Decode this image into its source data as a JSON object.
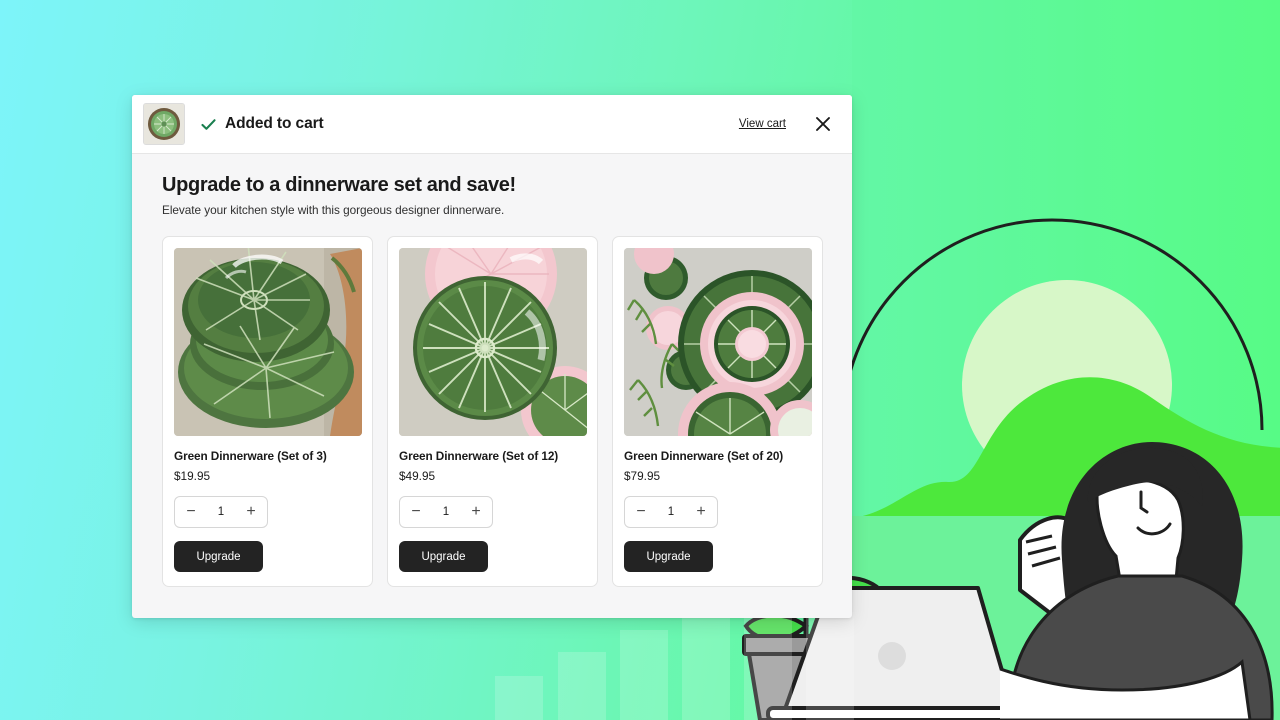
{
  "background": {
    "gradient_from": "#7DF4FA",
    "gradient_to": "#57FB86",
    "hill_color": "#4DE83C",
    "sun_color": "#D7F7C8",
    "coin_color": "#FBE56B",
    "accent_green": "#3FD935"
  },
  "header": {
    "thumbnail_alt": "Green Dinnerware plate thumbnail",
    "check_icon": "check-icon",
    "check_color": "#1a7f4f",
    "title": "Added to cart",
    "view_cart_label": "View cart",
    "close_icon": "close-icon"
  },
  "promo": {
    "title": "Upgrade to a dinnerware set and save!",
    "subtitle": "Elevate your kitchen style with this gorgeous designer dinnerware."
  },
  "products": [
    {
      "title": "Green Dinnerware (Set of 3)",
      "price": "$19.95",
      "quantity": "1",
      "decrease_label": "−",
      "increase_label": "+",
      "button_label": "Upgrade",
      "image_alt": "Stacked green cabbage-leaf bowl and plates"
    },
    {
      "title": "Green Dinnerware (Set of 12)",
      "price": "$49.95",
      "quantity": "1",
      "decrease_label": "−",
      "increase_label": "+",
      "button_label": "Upgrade",
      "image_alt": "Green cabbage plate over pink plates, top view"
    },
    {
      "title": "Green Dinnerware (Set of 20)",
      "price": "$79.95",
      "quantity": "1",
      "decrease_label": "−",
      "increase_label": "+",
      "button_label": "Upgrade",
      "image_alt": "Flat lay of pink and green cabbage dinnerware with ferns"
    }
  ],
  "illustration": {
    "coin_symbol": "$",
    "alt": "Woman at laptop with money plant and hills"
  }
}
